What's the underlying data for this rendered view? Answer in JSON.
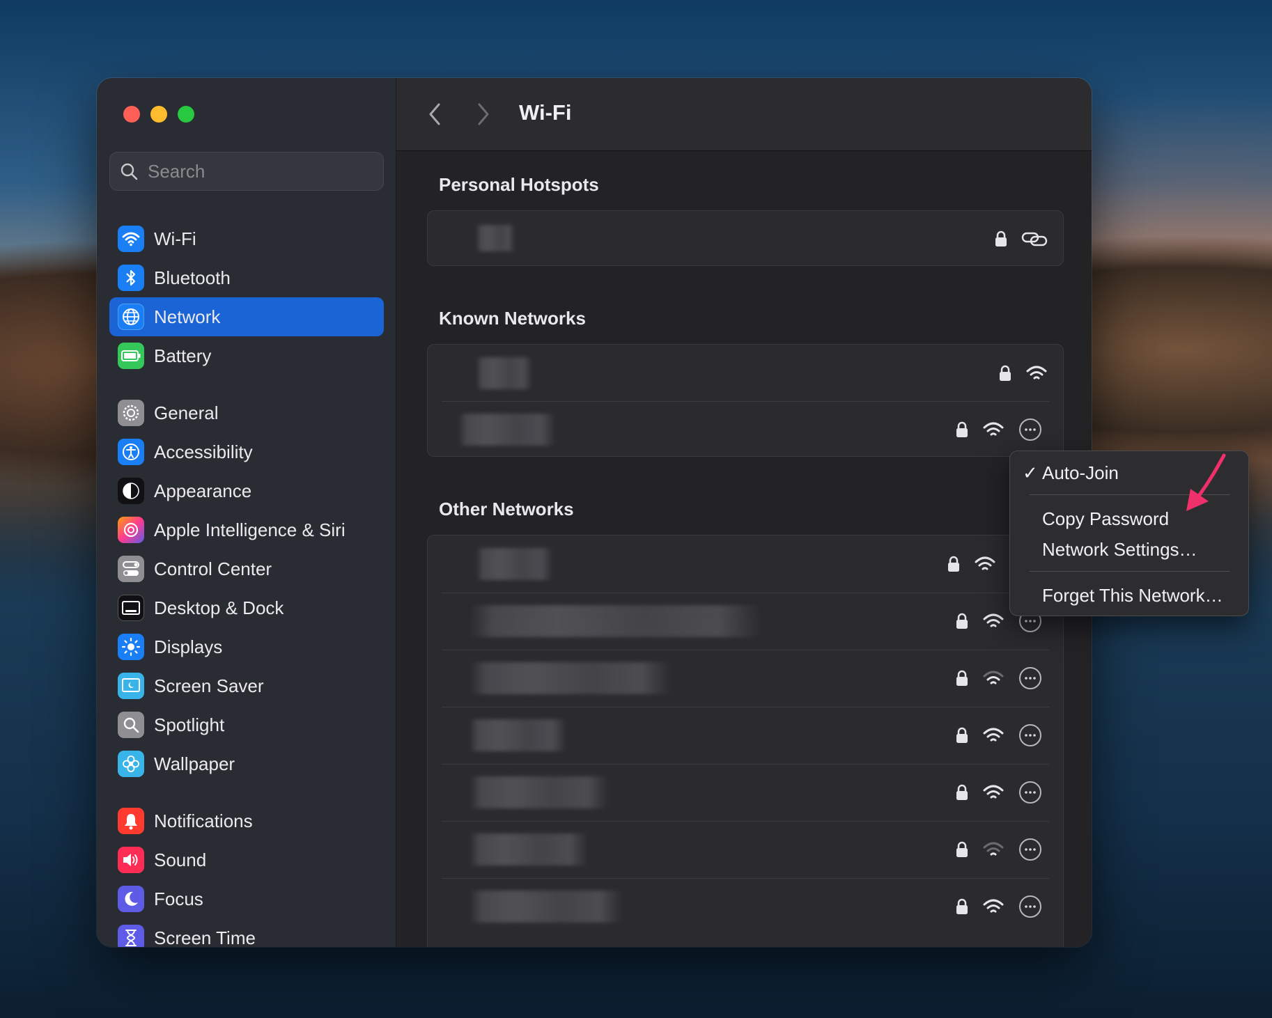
{
  "window": {
    "title": "Wi-Fi"
  },
  "search": {
    "placeholder": "Search"
  },
  "sidebar": {
    "items": [
      {
        "label": "Wi-Fi",
        "icon": "wifi-icon",
        "color": "#1a7ff5"
      },
      {
        "label": "Bluetooth",
        "icon": "bluetooth-icon",
        "color": "#1a7ff5"
      },
      {
        "label": "Network",
        "icon": "globe-icon",
        "color": "#1a7ff5",
        "selected": true
      },
      {
        "label": "Battery",
        "icon": "battery-icon",
        "color": "#34c759"
      },
      {
        "label": "General",
        "icon": "gear-icon",
        "color": "#8e8e93"
      },
      {
        "label": "Accessibility",
        "icon": "accessibility-icon",
        "color": "#1a7ff5"
      },
      {
        "label": "Appearance",
        "icon": "appearance-icon",
        "color": "#1c1c1e"
      },
      {
        "label": "Apple Intelligence & Siri",
        "icon": "siri-icon",
        "color": "#ff6ea0"
      },
      {
        "label": "Control Center",
        "icon": "control-center-icon",
        "color": "#8e8e93"
      },
      {
        "label": "Desktop & Dock",
        "icon": "dock-icon",
        "color": "#1c1c1e"
      },
      {
        "label": "Displays",
        "icon": "sun-icon",
        "color": "#1a7ff5"
      },
      {
        "label": "Screen Saver",
        "icon": "screen-saver-icon",
        "color": "#39b4e8"
      },
      {
        "label": "Spotlight",
        "icon": "magnifier-icon",
        "color": "#8e8e93"
      },
      {
        "label": "Wallpaper",
        "icon": "flower-icon",
        "color": "#39b4e8"
      },
      {
        "label": "Notifications",
        "icon": "bell-icon",
        "color": "#ff3b30"
      },
      {
        "label": "Sound",
        "icon": "speaker-icon",
        "color": "#ff2d55"
      },
      {
        "label": "Focus",
        "icon": "moon-icon",
        "color": "#5e5ce6"
      },
      {
        "label": "Screen Time",
        "icon": "hourglass-icon",
        "color": "#5e5ce6"
      }
    ]
  },
  "sections": {
    "hotspots_title": "Personal Hotspots",
    "known_title": "Known Networks",
    "other_title": "Other Networks"
  },
  "context_menu": {
    "checkmark": "✓",
    "auto_join": "Auto-Join",
    "copy_password": "Copy Password",
    "network_settings": "Network Settings…",
    "forget": "Forget This Network…"
  },
  "colors": {
    "accent": "#1a64d6",
    "annotation_arrow": "#f0306a"
  }
}
